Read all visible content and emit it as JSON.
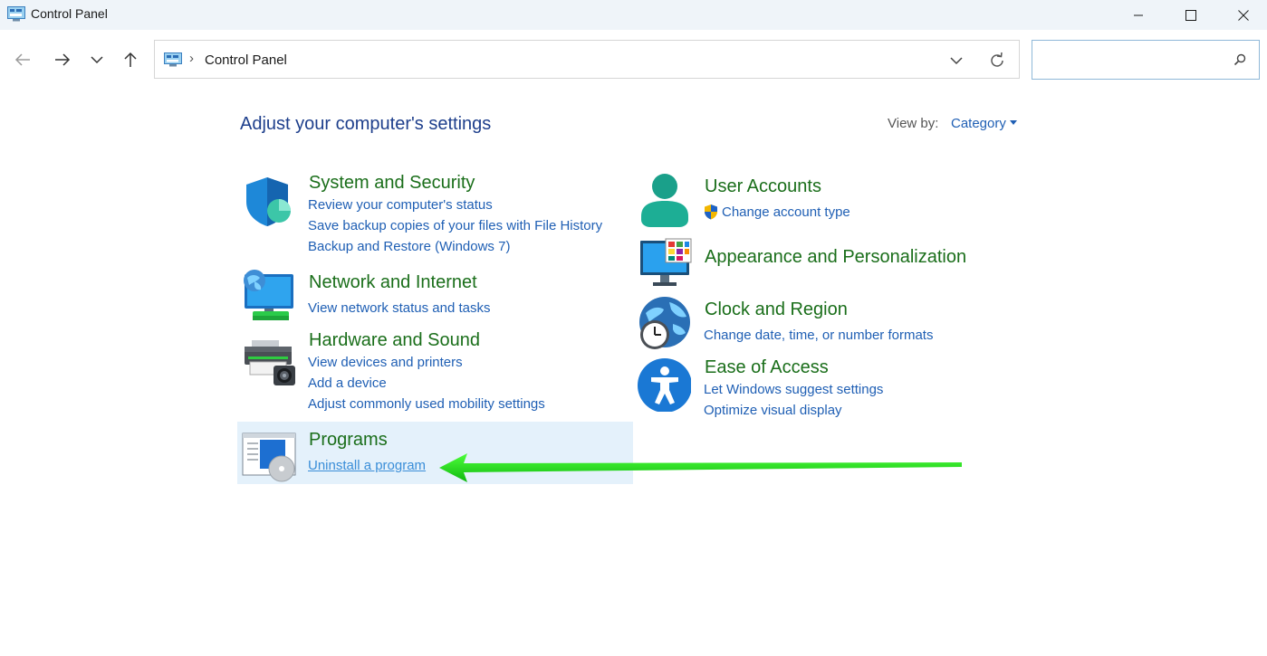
{
  "window": {
    "title": "Control Panel"
  },
  "address": {
    "path": "Control Panel",
    "separator": "›"
  },
  "search": {
    "placeholder": ""
  },
  "main": {
    "heading": "Adjust your computer's settings",
    "view_by_label": "View by:",
    "view_by_value": "Category"
  },
  "categories": [
    {
      "title": "System and Security",
      "icon": "shield-icon",
      "links": [
        "Review your computer's status",
        "Save backup copies of your files with File History",
        "Backup and Restore (Windows 7)"
      ]
    },
    {
      "title": "Network and Internet",
      "icon": "network-icon",
      "links": [
        "View network status and tasks"
      ]
    },
    {
      "title": "Hardware and Sound",
      "icon": "printer-icon",
      "links": [
        "View devices and printers",
        "Add a device",
        "Adjust commonly used mobility settings"
      ]
    },
    {
      "title": "Programs",
      "icon": "programs-icon",
      "links": [
        "Uninstall a program"
      ]
    },
    {
      "title": "User Accounts",
      "icon": "user-icon",
      "links": [
        "Change account type"
      ]
    },
    {
      "title": "Appearance and Personalization",
      "icon": "monitor-icon",
      "links": []
    },
    {
      "title": "Clock and Region",
      "icon": "clock-globe-icon",
      "links": [
        "Change date, time, or number formats"
      ]
    },
    {
      "title": "Ease of Access",
      "icon": "accessibility-icon",
      "links": [
        "Let Windows suggest settings",
        "Optimize visual display"
      ]
    }
  ],
  "colors": {
    "title_green": "#1a6e1a",
    "link_blue": "#1f5fb4",
    "heading_blue": "#1e3f8c",
    "arrow_green": "#22e01c",
    "highlight": "#e4f1fb"
  }
}
